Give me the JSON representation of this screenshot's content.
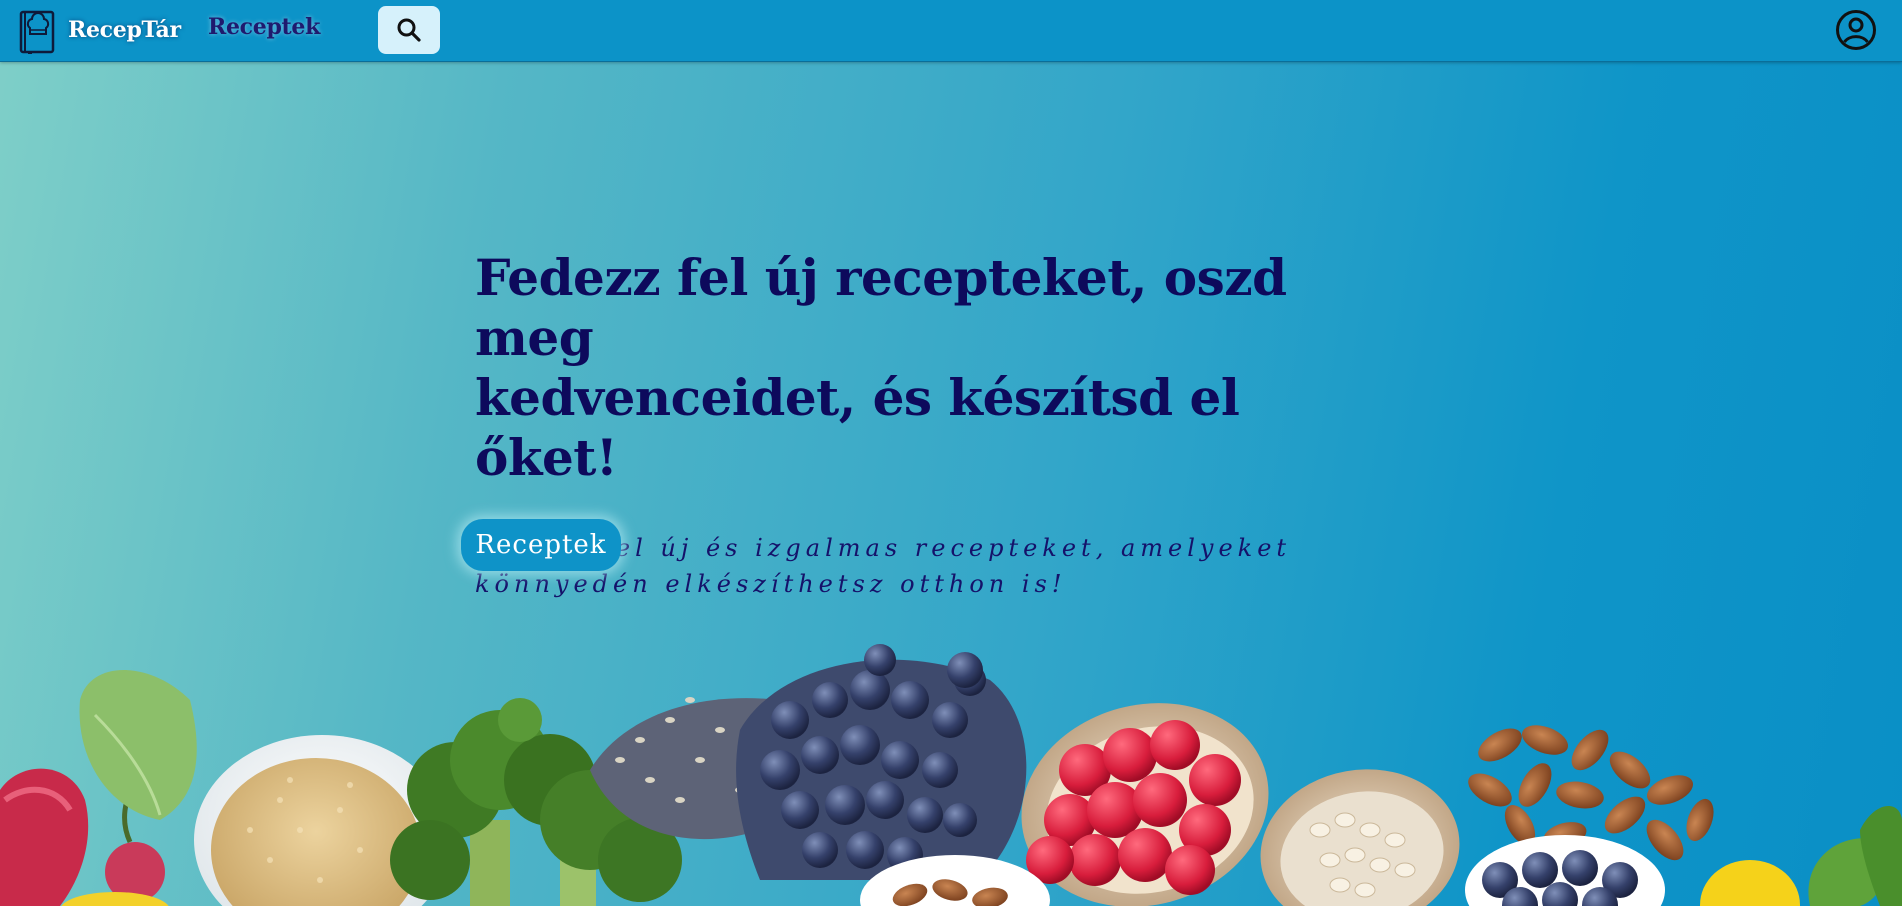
{
  "navbar": {
    "brand_name": "RecepTár",
    "link_recipes": "Receptek",
    "search_icon": "search-icon",
    "profile_icon": "user-circle-icon",
    "logo_icon": "chef-book-icon"
  },
  "hero": {
    "title_line1": "Fedezz fel új recepteket, oszd meg",
    "title_line2": "kedvenceidet, és készítsd el őket!",
    "subtitle_line1": "Fedezz fel új és izgalmas recepteket, amelyeket",
    "subtitle_line2": "könnyedén elkészíthetsz otthon is!",
    "cta_label": "Receptek"
  },
  "colors": {
    "navbar": "#0c93c8",
    "title": "#0d0a5c",
    "cta": "#0e93c8",
    "search_button_bg": "#d6f1fb"
  }
}
